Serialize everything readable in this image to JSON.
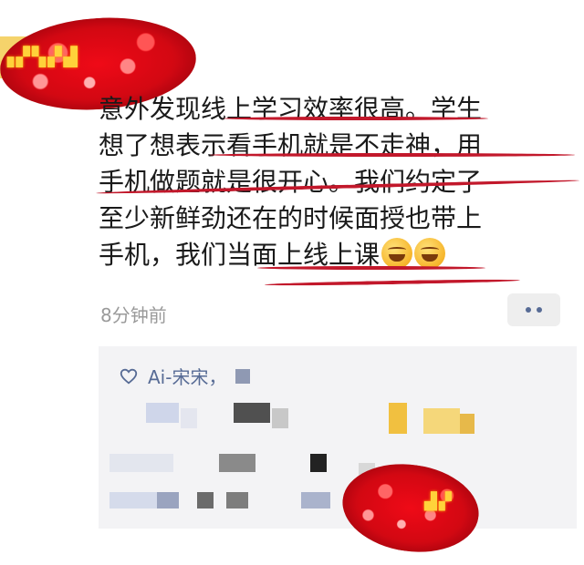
{
  "post": {
    "lines": [
      "意外发现线上学习效率很高。学生",
      "想了想表示看手机就是不走神，用",
      "手机做题就是很开心。我们约定了",
      "至少新鲜劲还在的时候面授也带上",
      "手机，我们当面上线上课"
    ],
    "timestamp": "8分钟前"
  },
  "likes": {
    "first_name": "Ai-宋宋，"
  },
  "colors": {
    "link_blue": "#576b95",
    "underline_red": "#c2182b",
    "glitter_red": "#d1121d"
  },
  "icons": {
    "like": "heart-outline-icon",
    "more": "more-dots-icon",
    "emoji1": "tears-of-joy-emoji",
    "emoji2": "facepalm-laugh-emoji"
  }
}
